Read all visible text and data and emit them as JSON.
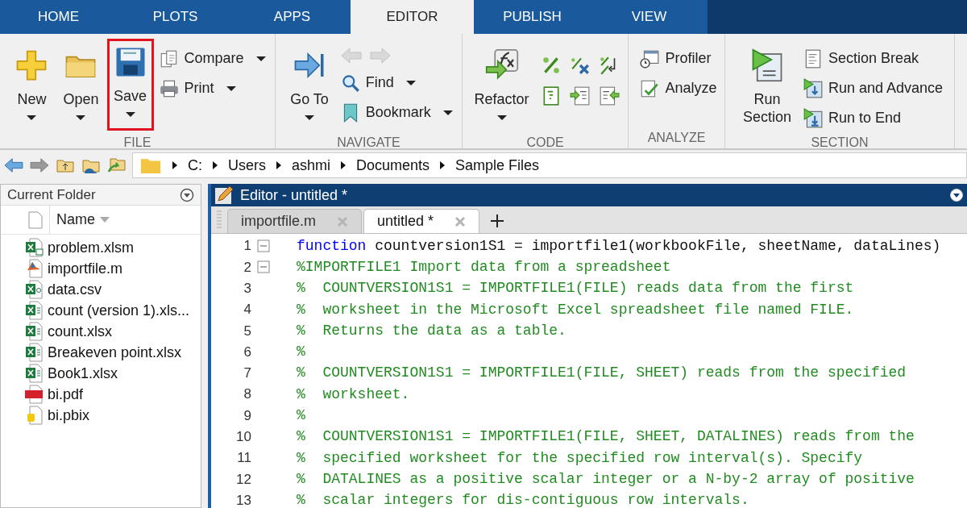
{
  "tabs": [
    {
      "label": "HOME",
      "selected": false
    },
    {
      "label": "PLOTS",
      "selected": false
    },
    {
      "label": "APPS",
      "selected": false
    },
    {
      "label": "EDITOR",
      "selected": true
    },
    {
      "label": "PUBLISH",
      "selected": false
    },
    {
      "label": "VIEW",
      "selected": false
    }
  ],
  "ribbon": {
    "groups": [
      {
        "label": "FILE",
        "columns": [
          [
            {
              "kind": "large",
              "label": "New",
              "dropdown": true,
              "highlighted": false
            }
          ],
          [
            {
              "kind": "large",
              "label": "Open",
              "dropdown": true,
              "highlighted": false
            }
          ],
          [
            {
              "kind": "large",
              "label": "Save",
              "dropdown": true,
              "highlighted": true
            }
          ],
          [
            {
              "kind": "small",
              "label": "Compare",
              "dropdown": true
            },
            {
              "kind": "small",
              "label": "Print",
              "dropdown": true
            }
          ]
        ]
      },
      {
        "label": "NAVIGATE",
        "columns": [
          [
            {
              "kind": "large",
              "label": "Go To",
              "dropdown": true,
              "highlighted": false
            }
          ],
          [
            {
              "kind": "icon-pair",
              "disabled": true
            },
            {
              "kind": "small",
              "label": "Find",
              "dropdown": true
            },
            {
              "kind": "small",
              "label": "Bookmark",
              "dropdown": true
            }
          ]
        ]
      },
      {
        "label": "CODE",
        "columns": [
          [
            {
              "kind": "large",
              "label": "Refactor",
              "dropdown": true,
              "highlighted": false
            }
          ],
          [
            {
              "kind": "icon"
            },
            {
              "kind": "icon"
            }
          ],
          [
            {
              "kind": "icon"
            },
            {
              "kind": "icon"
            }
          ],
          [
            {
              "kind": "icon"
            },
            {
              "kind": "icon"
            }
          ]
        ]
      },
      {
        "label": "ANALYZE",
        "columns": [
          [
            {
              "kind": "small",
              "label": "Profiler",
              "dropdown": false
            },
            {
              "kind": "small",
              "label": "Analyze",
              "dropdown": false
            }
          ]
        ]
      },
      {
        "label": "SECTION",
        "columns": [
          [
            {
              "kind": "large",
              "label": "Run\nSection",
              "dropdown": false,
              "highlighted": false
            }
          ],
          [
            {
              "kind": "small",
              "label": "Section Break",
              "dropdown": false
            },
            {
              "kind": "small",
              "label": "Run and Advance",
              "dropdown": false
            },
            {
              "kind": "small",
              "label": "Run to End",
              "dropdown": false
            }
          ]
        ]
      }
    ]
  },
  "address_bar": {
    "path": [
      "C:",
      "Users",
      "ashmi",
      "Documents",
      "Sample Files"
    ]
  },
  "current_folder": {
    "title": "Current Folder",
    "column": "Name",
    "files": [
      {
        "name": "problem.xlsm",
        "kind": "xlsm"
      },
      {
        "name": "importfile.m",
        "kind": "m"
      },
      {
        "name": "data.csv",
        "kind": "csv"
      },
      {
        "name": "count (version 1).xls...",
        "kind": "xlsx"
      },
      {
        "name": "count.xlsx",
        "kind": "xlsx"
      },
      {
        "name": "Breakeven point.xlsx",
        "kind": "xlsx"
      },
      {
        "name": "Book1.xlsx",
        "kind": "xlsx"
      },
      {
        "name": "bi.pdf",
        "kind": "pdf"
      },
      {
        "name": "bi.pbix",
        "kind": "pbix"
      }
    ]
  },
  "editor": {
    "title": "Editor - untitled *",
    "tabs": [
      {
        "label": "importfile.m",
        "selected": false
      },
      {
        "label": "untitled *",
        "selected": true
      }
    ],
    "lines": [
      {
        "number": "1",
        "fold": true,
        "segments": [
          {
            "kind": "keyword",
            "text": "function"
          },
          {
            "kind": "plain",
            "text": "countversion1S1 = importfile1(workbookFile, sheetName, dataLines)"
          }
        ]
      },
      {
        "number": "2",
        "fold": true,
        "segments": [
          {
            "kind": "comment",
            "text": "%IMPORTFILE1 Import data from a spreadsheet"
          }
        ]
      },
      {
        "number": "3",
        "fold": false,
        "segments": [
          {
            "kind": "comment",
            "text": "%  COUNTVERSION1S1 = IMPORTFILE1(FILE) reads data from the first"
          }
        ]
      },
      {
        "number": "4",
        "fold": false,
        "segments": [
          {
            "kind": "comment",
            "text": "%  worksheet in the Microsoft Excel spreadsheet file named FILE."
          }
        ]
      },
      {
        "number": "5",
        "fold": false,
        "segments": [
          {
            "kind": "comment",
            "text": "%  Returns the data as a table."
          }
        ]
      },
      {
        "number": "6",
        "fold": false,
        "segments": [
          {
            "kind": "comment",
            "text": "%"
          }
        ]
      },
      {
        "number": "7",
        "fold": false,
        "segments": [
          {
            "kind": "comment",
            "text": "%  COUNTVERSION1S1 = IMPORTFILE1(FILE, SHEET) reads from the specified"
          }
        ]
      },
      {
        "number": "8",
        "fold": false,
        "segments": [
          {
            "kind": "comment",
            "text": "%  worksheet."
          }
        ]
      },
      {
        "number": "9",
        "fold": false,
        "segments": [
          {
            "kind": "comment",
            "text": "%"
          }
        ]
      },
      {
        "number": "10",
        "fold": false,
        "segments": [
          {
            "kind": "comment",
            "text": "%  COUNTVERSION1S1 = IMPORTFILE1(FILE, SHEET, DATALINES) reads from the"
          }
        ]
      },
      {
        "number": "11",
        "fold": false,
        "segments": [
          {
            "kind": "comment",
            "text": "%  specified worksheet for the specified row interval(s). Specify"
          }
        ]
      },
      {
        "number": "12",
        "fold": false,
        "segments": [
          {
            "kind": "comment",
            "text": "%  DATALINES as a positive scalar integer or a N-by-2 array of positive"
          }
        ]
      },
      {
        "number": "13",
        "fold": false,
        "segments": [
          {
            "kind": "comment",
            "text": "%  scalar integers for dis-contiguous row intervals."
          }
        ]
      }
    ]
  }
}
